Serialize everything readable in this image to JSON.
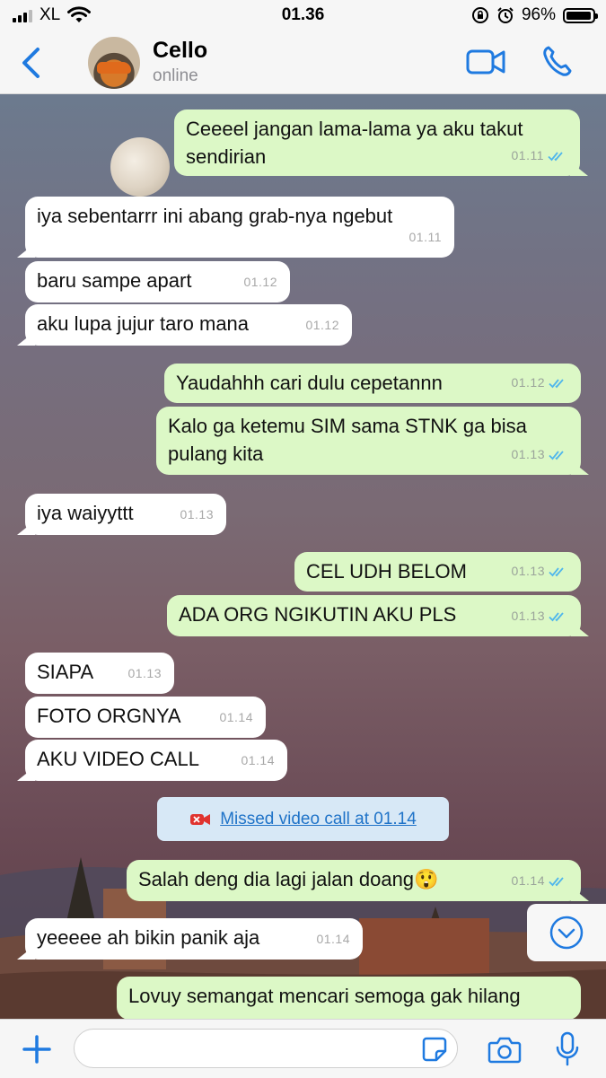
{
  "status_bar": {
    "carrier": "XL",
    "time": "01.36",
    "battery_percent_label": "96%",
    "battery_level": 0.96
  },
  "header": {
    "contact_name": "Cello",
    "contact_status": "online"
  },
  "messages": [
    {
      "dir": "out",
      "text": "Ceeeel jangan lama-lama ya aku takut sendirian",
      "time": "01.11",
      "read": true
    },
    {
      "dir": "in",
      "text": "iya sebentarrr ini abang grab-nya ngebut",
      "time": "01.11"
    },
    {
      "dir": "in",
      "text": "baru sampe apart",
      "time": "01.12"
    },
    {
      "dir": "in",
      "text": "aku lupa jujur taro mana",
      "time": "01.12"
    },
    {
      "dir": "out",
      "text": "Yaudahhh cari dulu cepetannn",
      "time": "01.12",
      "read": true
    },
    {
      "dir": "out",
      "text": "Kalo ga ketemu SIM sama STNK ga bisa pulang kita",
      "time": "01.13",
      "read": true
    },
    {
      "dir": "in",
      "text": "iya waiyyttt",
      "time": "01.13"
    },
    {
      "dir": "out",
      "text": "CEL UDH BELOM",
      "time": "01.13",
      "read": true
    },
    {
      "dir": "out",
      "text": "ADA ORG NGIKUTIN AKU PLS",
      "time": "01.13",
      "read": true
    },
    {
      "dir": "in",
      "text": "SIAPA",
      "time": "01.13"
    },
    {
      "dir": "in",
      "text": "FOTO ORGNYA",
      "time": "01.14"
    },
    {
      "dir": "in",
      "text": "AKU VIDEO CALL",
      "time": "01.14"
    },
    {
      "dir": "out",
      "text": "Salah deng dia lagi jalan doang😲",
      "time": "01.14",
      "read": true
    },
    {
      "dir": "in",
      "text": "yeeeee ah bikin panik aja",
      "time": "01.14"
    },
    {
      "dir": "out",
      "text": "Lovuy semangat mencari semoga gak hilang",
      "time": "",
      "read": true
    }
  ],
  "missed_call": {
    "label": "Missed video call at 01.14"
  },
  "input": {
    "placeholder": "",
    "value": ""
  },
  "colors": {
    "accent": "#1f7ae0",
    "incoming_bubble": "#ffffff",
    "outgoing_bubble": "#dcf8c6",
    "read_tick": "#4fb6ec",
    "missed_call_red": "#e0332f"
  }
}
